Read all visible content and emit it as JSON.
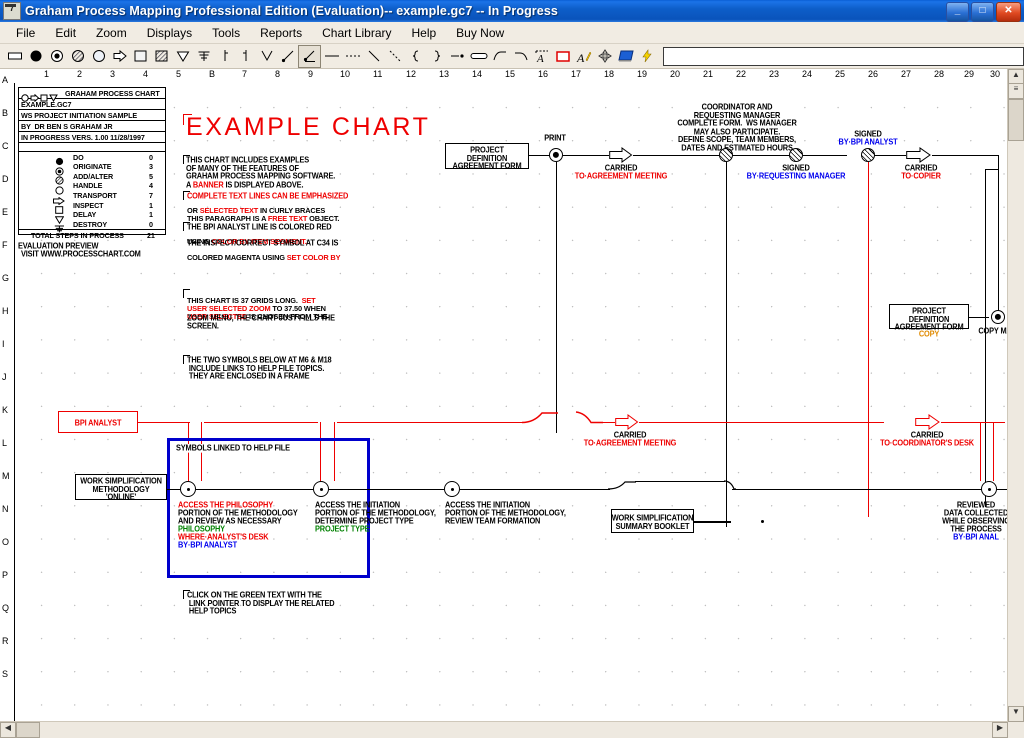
{
  "window": {
    "title": "Graham Process Mapping Professional Edition (Evaluation)-- example.gc7 -- In Progress",
    "app_icon": "document-icon",
    "minimize": "_",
    "maximize": "□",
    "close": "✕"
  },
  "menu": {
    "items": [
      {
        "label": "File"
      },
      {
        "label": "Edit"
      },
      {
        "label": "Zoom"
      },
      {
        "label": "Displays"
      },
      {
        "label": "Tools"
      },
      {
        "label": "Reports"
      },
      {
        "label": "Chart Library"
      },
      {
        "label": "Help"
      },
      {
        "label": "Buy Now"
      }
    ]
  },
  "toolbar": {
    "tools": [
      {
        "name": "rectangle-box-icon",
        "selected": false
      },
      {
        "name": "do-symbol-icon",
        "selected": false
      },
      {
        "name": "originate-symbol-icon",
        "selected": false
      },
      {
        "name": "add-alter-symbol-icon",
        "selected": false
      },
      {
        "name": "handle-symbol-icon",
        "selected": false
      },
      {
        "name": "transport-symbol-icon",
        "selected": false
      },
      {
        "name": "inspect-symbol-icon",
        "selected": false
      },
      {
        "name": "inspect-hatched-symbol-icon",
        "selected": false
      },
      {
        "name": "delay-symbol-icon",
        "selected": false
      },
      {
        "name": "destroy-symbol-icon",
        "selected": false
      },
      {
        "name": "junction-left-icon",
        "selected": false
      },
      {
        "name": "junction-right-icon",
        "selected": false
      },
      {
        "name": "vee-merge-icon",
        "selected": false
      },
      {
        "name": "line-up-dot-icon",
        "selected": false
      },
      {
        "name": "line-up-dot-selected-icon",
        "selected": true
      },
      {
        "name": "solid-line-icon",
        "selected": false
      },
      {
        "name": "dashed-line-icon",
        "selected": false
      },
      {
        "name": "diagonal-line-icon",
        "selected": false
      },
      {
        "name": "diagonal-dashed-line-icon",
        "selected": false
      },
      {
        "name": "brace-open-icon",
        "selected": false
      },
      {
        "name": "brace-close-icon",
        "selected": false
      },
      {
        "name": "line-dot-icon",
        "selected": false
      },
      {
        "name": "rounded-bar-icon",
        "selected": false
      },
      {
        "name": "curve-left-icon",
        "selected": false
      },
      {
        "name": "curve-right-icon",
        "selected": false
      },
      {
        "name": "banner-text-icon",
        "selected": false
      },
      {
        "name": "free-text-frame-icon",
        "selected": false
      },
      {
        "name": "edit-text-icon",
        "selected": false
      },
      {
        "name": "move-icon",
        "selected": false
      },
      {
        "name": "book-icon",
        "selected": false
      },
      {
        "name": "lightning-icon",
        "selected": false
      }
    ],
    "edit_field_value": "",
    "edit_field_placeholder": ""
  },
  "rulers": {
    "horizontal": [
      "1",
      "2",
      "3",
      "4",
      "5",
      "B",
      "7",
      "8",
      "9",
      "10",
      "11",
      "12",
      "13",
      "14",
      "15",
      "16",
      "17",
      "18",
      "19",
      "20",
      "21",
      "22",
      "23",
      "24",
      "25",
      "26",
      "27",
      "28",
      "29",
      "30"
    ],
    "vertical": [
      "A",
      "B",
      "C",
      "D",
      "E",
      "F",
      "G",
      "H",
      "I",
      "J",
      "K",
      "L",
      "M",
      "N",
      "O",
      "P",
      "Q",
      "R",
      "S"
    ]
  },
  "legend": {
    "header": "GRAHAM PROCESS CHART",
    "header_icons": [
      "handle-symbol-icon",
      "transport-symbol-icon",
      "inspect-symbol-icon",
      "delay-symbol-icon"
    ],
    "filename": "EXAMPLE.GC7",
    "subtitle": "WS PROJECT INITIATION SAMPLE",
    "author": "BY  DR BEN S GRAHAM JR",
    "version": "IN PROGRESS VERS. 1.00 11/28/1997",
    "counts": [
      {
        "icon": "do-symbol-icon",
        "label": "DO",
        "value": "0"
      },
      {
        "icon": "originate-symbol-icon",
        "label": "ORIGINATE",
        "value": "3"
      },
      {
        "icon": "add-alter-symbol-icon",
        "label": "ADD/ALTER",
        "value": "5"
      },
      {
        "icon": "handle-symbol-icon",
        "label": "HANDLE",
        "value": "4"
      },
      {
        "icon": "transport-symbol-icon",
        "label": "TRANSPORT",
        "value": "7"
      },
      {
        "icon": "inspect-symbol-icon",
        "label": "INSPECT",
        "value": "1"
      },
      {
        "icon": "delay-symbol-icon",
        "label": "DELAY",
        "value": "1"
      },
      {
        "icon": "destroy-symbol-icon",
        "label": "DESTROY",
        "value": "0"
      }
    ],
    "total_label": "TOTAL STEPS IN PROCESS",
    "total_value": "21",
    "footer_line1": "EVALUATION PREVIEW",
    "footer_line2": "VISIT WWW.PROCESSCHART.COM"
  },
  "chart": {
    "banner_title": "EXAMPLE CHART",
    "note1": "THIS CHART INCLUDES EXAMPLES\nOF MANY OF THE FEATURES OF\nGRAHAM PROCESS MAPPING SOFTWARE.\nA ",
    "note1_hl": "BANNER",
    "note1_tail": " IS DISPLAYED ABOVE.",
    "note2_hl1": "COMPLETE TEXT LINES CAN BE EMPHASIZED",
    "note2_a": "OR ",
    "note2_hl2": "SELECTED TEXT",
    "note2_b": " IN CURLY BRACES",
    "note2_c": "THIS PARAGRAPH IS A ",
    "note2_hl3": "FREE TEXT",
    "note2_d": " OBJECT.",
    "note3_a": "THE BPI ANALYST LINE IS COLORED RED",
    "note3_b": "USING ",
    "note3_hl1": "COLOR BY ITEM SEGMENT.",
    "note3_c": "THE INSPECT/CORRECT SYMBOL AT C34 IS",
    "note3_d": "COLORED MAGENTA USING ",
    "note3_hl2": "SET COLOR BY",
    "note4_a": "THIS CHART IS 37 GRIDS LONG.  ",
    "note4_hl1": "SET",
    "note4_hl2": "USER SELECTED ZOOM",
    "note4_b": " TO 37.50 WHEN",
    "note4_hl3": "USER SELECTED",
    "note4_c": " IS CHOSEN FROM THE",
    "note4_d": "ZOOM MENU, THE CHART JUST FILLS THE",
    "note4_e": "SCREEN.",
    "note5": "THE TWO SYMBOLS BELOW AT M6 & M18\n INCLUDE LINKS TO HELP FILE TOPICS.\n THEY ARE ENCLOSED IN A FRAME",
    "note6": "CLICK ON THE GREEN TEXT WITH THE\n LINK POINTER TO DISPLAY THE RELATED\n HELP TOPICS",
    "frame_label": "SYMBOLS LINKED TO HELP FILE",
    "boxes": [
      {
        "id": "project-definition-agreement-form",
        "lines": "PROJECT\nDEFINITION\nAGREEMENT FORM"
      },
      {
        "id": "bpi-analyst",
        "lines": "BPI ANALYST",
        "color": "red"
      },
      {
        "id": "work-simplification-methodology",
        "lines": "WORK SIMPLIFICATION\nMETHODOLOGY\n'ONLINE'"
      },
      {
        "id": "work-simplification-summary-booklet",
        "lines": "WORK SIMPLIFICATION\nSUMMARY BOOKLET"
      },
      {
        "id": "project-definition-agreement-form-copy",
        "lines": "PROJECT\nDEFINITION\nAGREEMENT FORM"
      }
    ],
    "labels": [
      {
        "id": "print",
        "text": "PRINT"
      },
      {
        "id": "carried-to-agreement-meeting-1",
        "top": "CARRIED",
        "bottom": "TO·AGREEMENT MEETING"
      },
      {
        "id": "coordinator-note",
        "text": "COORDINATOR AND\nREQUESTING MANAGER\nCOMPLETE FORM.  WS MANAGER\nMAY ALSO PARTICIPATE.\nDEFINE SCOPE, TEAM MEMBERS,\nDATES AND ESTIMATED HOURS"
      },
      {
        "id": "signed-by-requesting-manager",
        "top": "SIGNED",
        "bottom": "BY·REQUESTING MANAGER"
      },
      {
        "id": "signed-by-bpi-analyst",
        "top": "SIGNED",
        "bottom": "BY·BPI ANALYST"
      },
      {
        "id": "carried-to-copier",
        "top": "CARRIED",
        "bottom": "TO·COPIER"
      },
      {
        "id": "copy-made",
        "text": "COPY MADE"
      },
      {
        "id": "copy-label",
        "text": "COPY"
      },
      {
        "id": "carried-to-agreement-meeting-2",
        "top": "CARRIED",
        "bottom": "TO·AGREEMENT MEETING"
      },
      {
        "id": "carried-to-coordinators-desk",
        "top": "CARRIED",
        "bottom": "TO·COORDINATOR'S DESK"
      },
      {
        "id": "access-philosophy",
        "l1": "ACCESS THE PHILOSOPHY",
        "l2": "PORTION OF THE METHODOLOGY",
        "l3": "AND REVIEW AS NECESSARY",
        "l4": "PHILOSOPHY",
        "l5": "WHERE·ANALYST'S DESK",
        "l6": "BY·BPI ANALYST"
      },
      {
        "id": "access-initiation-project-type",
        "l1": "ACCESS THE INITIATION",
        "l2": "PORTION OF THE METHODOLOGY,",
        "l3": "DETERMINE PROJECT TYPE",
        "l4": "PROJECT TYPE"
      },
      {
        "id": "access-initiation-team-formation",
        "l1": "ACCESS THE INITIATION",
        "l2": "PORTION OF THE METHODOLOGY,",
        "l3": "REVIEW TEAM FORMATION"
      },
      {
        "id": "reviewed-data-collected",
        "l1": "REVIEWED",
        "l2": "DATA COLLECTED",
        "l3": "WHILE OBSERVING",
        "l4": "THE PROCESS",
        "l5": "BY·BPI ANAL"
      }
    ]
  }
}
